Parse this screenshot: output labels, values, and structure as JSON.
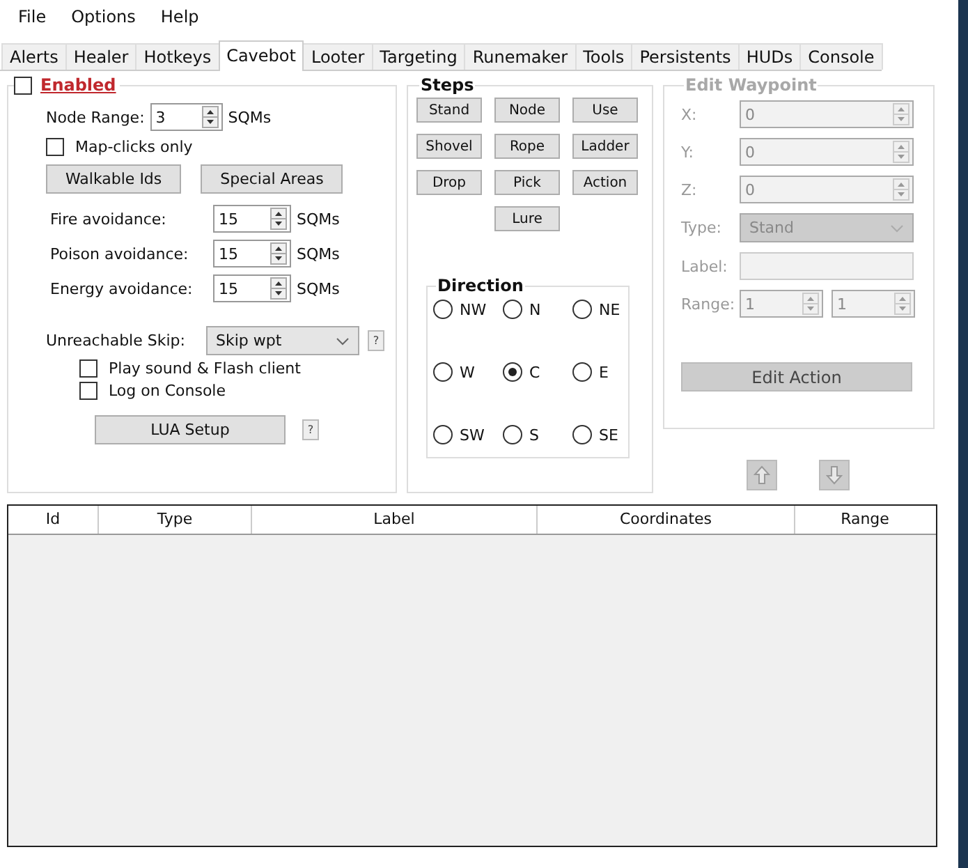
{
  "menu": [
    "File",
    "Options",
    "Help"
  ],
  "tabs": [
    {
      "label": "Alerts",
      "selected": false
    },
    {
      "label": "Healer",
      "selected": false
    },
    {
      "label": "Hotkeys",
      "selected": false
    },
    {
      "label": "Cavebot",
      "selected": true
    },
    {
      "label": "Looter",
      "selected": false
    },
    {
      "label": "Targeting",
      "selected": false
    },
    {
      "label": "Runemaker",
      "selected": false
    },
    {
      "label": "Tools",
      "selected": false
    },
    {
      "label": "Persistents",
      "selected": false
    },
    {
      "label": "HUDs",
      "selected": false
    },
    {
      "label": "Console",
      "selected": false
    }
  ],
  "general": {
    "enabled": {
      "label": "Enabled",
      "checked": false
    },
    "node_range": {
      "label": "Node Range:",
      "value": "3",
      "unit": "SQMs"
    },
    "map_clicks_only": {
      "label": "Map-clicks only",
      "checked": false
    },
    "buttons": [
      "Walkable Ids",
      "Special Areas"
    ],
    "avoidance": [
      {
        "label": "Fire avoidance:",
        "value": "15",
        "unit": "SQMs"
      },
      {
        "label": "Poison avoidance:",
        "value": "15",
        "unit": "SQMs"
      },
      {
        "label": "Energy avoidance:",
        "value": "15",
        "unit": "SQMs"
      }
    ],
    "unreachable_skip": {
      "label": "Unreachable Skip:",
      "value": "Skip wpt",
      "help": "?"
    },
    "options": [
      {
        "label": "Play sound & Flash client",
        "checked": false
      },
      {
        "label": "Log on Console",
        "checked": false
      }
    ],
    "lua_button": "LUA Setup",
    "lua_help": "?"
  },
  "steps": {
    "title": "Steps",
    "buttons": [
      "Stand",
      "Node",
      "Use",
      "Shovel",
      "Rope",
      "Ladder",
      "Drop",
      "Pick",
      "Action",
      "Lure"
    ],
    "direction": {
      "title": "Direction",
      "options": [
        {
          "label": "NW",
          "selected": false
        },
        {
          "label": "N",
          "selected": false
        },
        {
          "label": "NE",
          "selected": false
        },
        {
          "label": "W",
          "selected": false
        },
        {
          "label": "C",
          "selected": true
        },
        {
          "label": "E",
          "selected": false
        },
        {
          "label": "SW",
          "selected": false
        },
        {
          "label": "S",
          "selected": false
        },
        {
          "label": "SE",
          "selected": false
        }
      ]
    }
  },
  "edit_waypoint": {
    "title": "Edit Waypoint",
    "disabled": true,
    "coords": [
      {
        "label": "X:",
        "value": "0"
      },
      {
        "label": "Y:",
        "value": "0"
      },
      {
        "label": "Z:",
        "value": "0"
      }
    ],
    "type": {
      "label": "Type:",
      "value": "Stand"
    },
    "label_field": {
      "label": "Label:"
    },
    "range": {
      "label": "Range:",
      "values": [
        "1",
        "1"
      ]
    },
    "button": "Edit Action"
  },
  "table": {
    "columns": [
      "Id",
      "Type",
      "Label",
      "Coordinates",
      "Range"
    ]
  }
}
